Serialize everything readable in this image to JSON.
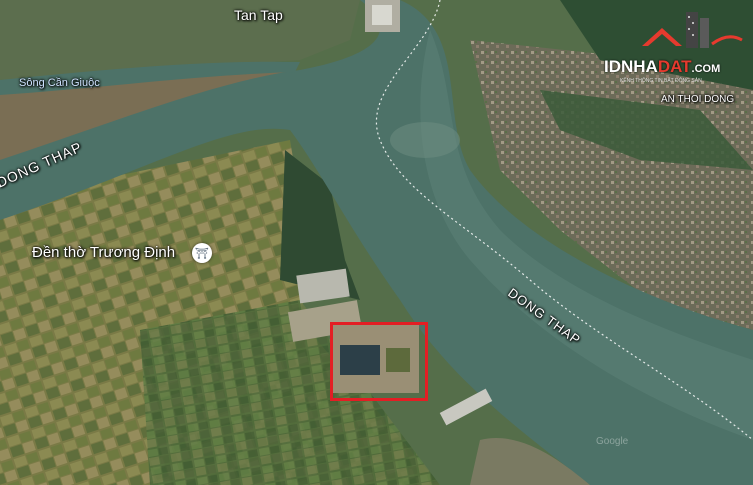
{
  "map": {
    "places": {
      "tan_tap": "Tan Tap",
      "song_can_giuoc": "Sông Cần Giuộc",
      "den_tho_truong_dinh": "Đền thờ Trương Định",
      "an_thoi_dong": "AN THOI DONG"
    },
    "provinces": {
      "dong_thap_west": "DONG THAP",
      "dong_thap_river": "DONG THAP"
    },
    "watermark": "Google",
    "logo": {
      "part1": "IDNHA",
      "part2": "DAT",
      "suffix": ".COM",
      "tagline": "KÊNH THÔNG TIN BẤT ĐỘNG SẢN"
    },
    "poi_icon": "temple-icon",
    "highlight_color": "#e31e24"
  }
}
